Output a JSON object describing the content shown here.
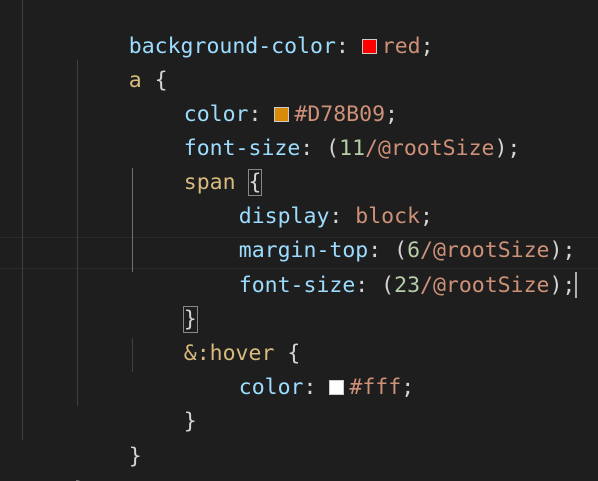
{
  "code": {
    "l1": {
      "prop": "background-color",
      "colon": ": ",
      "swatch": "#ff0000",
      "value": "red",
      "semi": ";"
    },
    "l2": {
      "selector": "a",
      "brace": " {"
    },
    "l3": {
      "prop": "color",
      "colon": ": ",
      "swatch": "#D78B09",
      "value": "#D78B09",
      "semi": ";"
    },
    "l4": {
      "prop": "font-size",
      "colon": ": ",
      "open": "(",
      "num": "11",
      "var": "/@rootSize",
      "close": ")",
      "semi": ";"
    },
    "l5": {
      "selector": "span",
      "space": " ",
      "brace": "{"
    },
    "l6": {
      "prop": "display",
      "colon": ": ",
      "value": "block",
      "semi": ";"
    },
    "l7": {
      "prop": "margin-top",
      "colon": ": ",
      "open": "(",
      "num": "6",
      "var": "/@rootSize",
      "close": ")",
      "semi": ";"
    },
    "l8": {
      "prop": "font-size",
      "colon": ": ",
      "open": "(",
      "num": "23",
      "var": "/@rootSize",
      "close": ")",
      "semi": ";"
    },
    "l9": {
      "brace": "}"
    },
    "l10": {
      "selector": "&:hover",
      "brace": " {"
    },
    "l11": {
      "prop": "color",
      "colon": ": ",
      "swatch": "#ffffff",
      "value": "#fff",
      "semi": ";"
    },
    "l12": {
      "brace": "}"
    },
    "l13": {
      "brace": "}"
    },
    "l14": {
      "brace": "}"
    }
  },
  "colors": {
    "background": "#1e1e1e",
    "property": "#9cdcfe",
    "value": "#ce9178",
    "number": "#b5cea8",
    "selector": "#d7ba7d"
  }
}
